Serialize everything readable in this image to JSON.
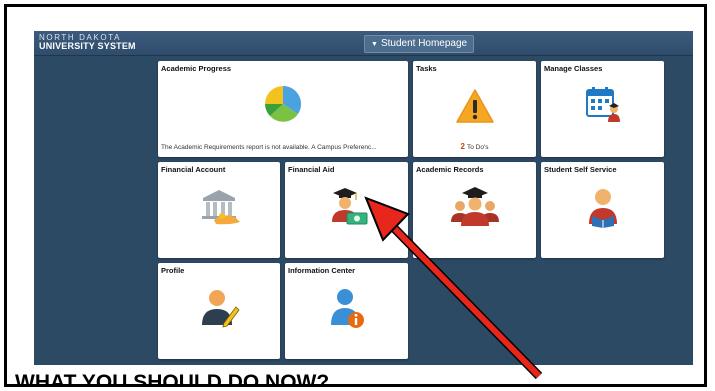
{
  "header": {
    "logo_line1": "NORTH DAKOTA",
    "logo_line2": "UNIVERSITY SYSTEM",
    "home_caret": "▼",
    "home_button": "Student Homepage"
  },
  "tiles": {
    "academic_progress": {
      "title": "Academic Progress",
      "note": "The Academic Requirements report is not available.  A Campus Preferenc..."
    },
    "tasks": {
      "title": "Tasks",
      "count": "2",
      "todo_label": "To Do's"
    },
    "manage_classes": {
      "title": "Manage Classes"
    },
    "financial_account": {
      "title": "Financial Account"
    },
    "financial_aid": {
      "title": "Financial Aid"
    },
    "academic_records": {
      "title": "Academic Records"
    },
    "student_self_service": {
      "title": "Student Self Service"
    },
    "profile": {
      "title": "Profile"
    },
    "information_center": {
      "title": "Information Center"
    }
  },
  "instruction_heading": "WHAT YOU SHOULD DO NOW?",
  "colors": {
    "app_background": "#2d4a65",
    "arrow": "#e8261c",
    "warning": "#f5a623",
    "accent_orange": "#e86a10"
  }
}
